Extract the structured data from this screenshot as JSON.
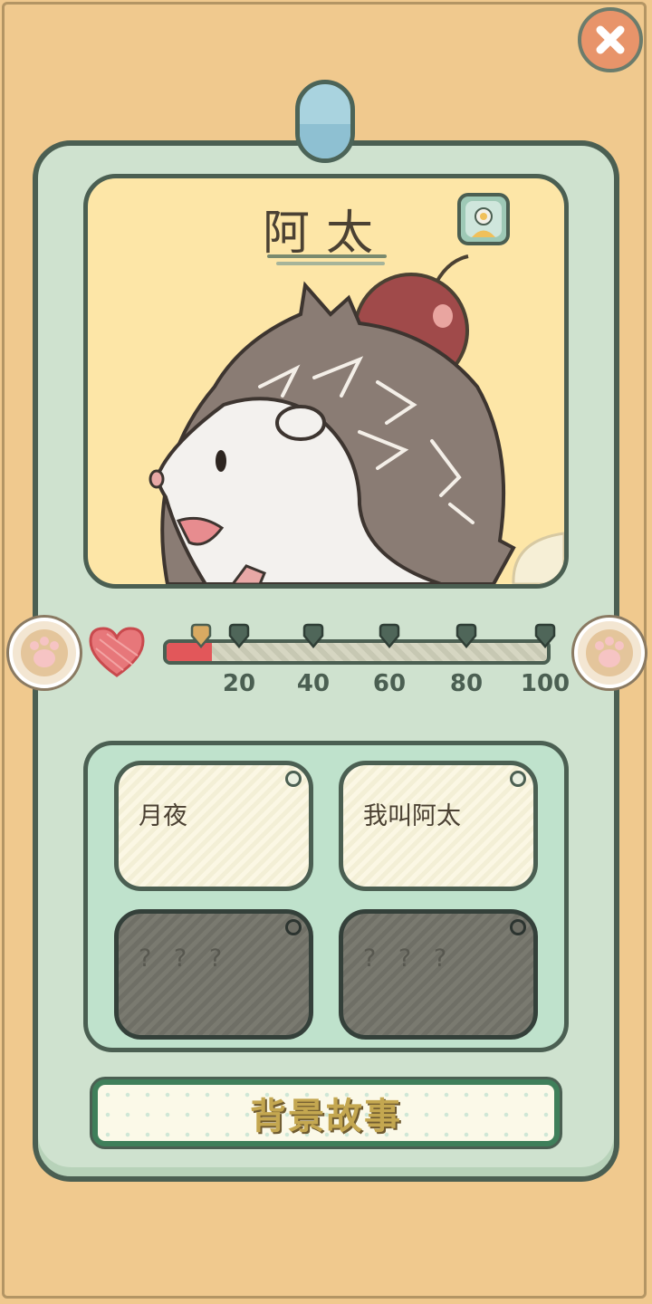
{
  "pet": {
    "name": "阿太"
  },
  "affection": {
    "progress_percent": 12,
    "ticks": [
      "20",
      "40",
      "60",
      "80",
      "100"
    ]
  },
  "stories": [
    {
      "label": "月夜",
      "locked": false
    },
    {
      "label": "我叫阿太",
      "locked": false
    },
    {
      "label": "? ? ?",
      "locked": true
    },
    {
      "label": "? ? ?",
      "locked": true
    }
  ],
  "backstory_button": {
    "label": "背景故事"
  },
  "colors": {
    "background": "#f0c98e",
    "card": "#cfe2cf",
    "portrait": "#fde6a7",
    "affection_fill": "#e2575a",
    "close_button": "#e8946a"
  },
  "icons": {
    "close": "close-icon",
    "avatar": "pet-avatar-icon",
    "paw": "paw-icon",
    "heart": "heart-icon"
  }
}
